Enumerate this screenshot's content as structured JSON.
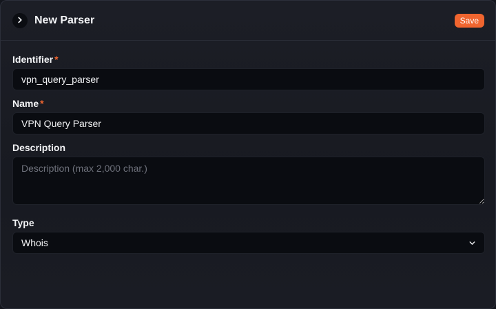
{
  "header": {
    "title": "New Parser",
    "save_label": "Save",
    "collapse_icon": "chevron-right-icon"
  },
  "fields": {
    "identifier": {
      "label": "Identifier",
      "required_mark": "*",
      "value": "vpn_query_parser"
    },
    "name": {
      "label": "Name",
      "required_mark": "*",
      "value": "VPN Query Parser"
    },
    "description": {
      "label": "Description",
      "placeholder": "Description (max 2,000 char.)",
      "value": ""
    },
    "type": {
      "label": "Type",
      "selected": "Whois",
      "dropdown_icon": "chevron-down-icon"
    }
  },
  "colors": {
    "accent": "#f0652f",
    "background": "#1b1d24",
    "input_background": "#0a0c11"
  }
}
